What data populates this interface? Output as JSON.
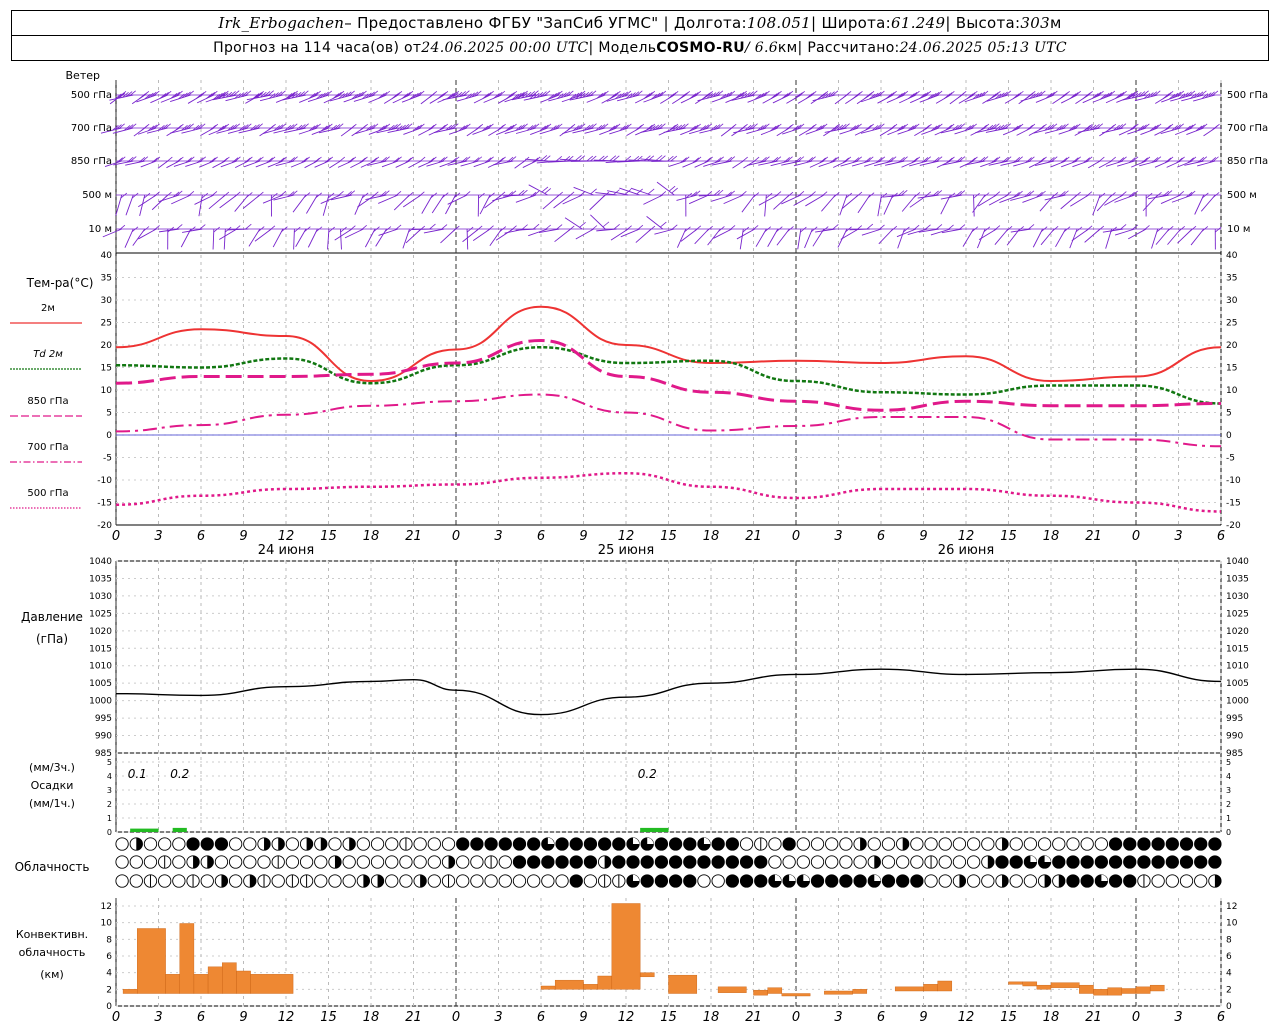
{
  "header": {
    "station": "Irk_Erbogachen",
    "provider": " – Предоставлено ФГБУ \"ЗапСиб УГМС\" | Долгота: ",
    "lon": "108.051",
    "lat_label": " | Широта: ",
    "lat": "61.249",
    "alt_label": " | Высота: ",
    "alt": "303",
    "alt_unit": "м",
    "fc_label": "Прогноз на 114 часа(ов) от ",
    "fc_start": "24.06.2025 00:00 UTC",
    "model_label": "  | Модель ",
    "model": "COSMO-RU",
    "res": " / 6.6",
    "res_unit": "км",
    "calc_label": " | Рассчитано: ",
    "calc": "24.06.2025 05:13 UTC"
  },
  "colors": {
    "wind": "#7722cc",
    "t2m": "#ee3333",
    "td2m": "#117711",
    "t850": "#e0198a",
    "precip": "#22bb22",
    "conv": "#ee8833"
  },
  "labels": {
    "wind": "Ветер",
    "wind_levels": [
      "500 гПа",
      "700 гПа",
      "850 гПа",
      "500 м",
      "10  м"
    ],
    "temp": "Тем-ра(°С)",
    "legend": [
      "2м",
      "Td  2м",
      "850 гПа",
      "700 гПа",
      "500 гПа"
    ],
    "pressure": [
      "Давление",
      "(гПа)"
    ],
    "precip": [
      "(мм/3ч.)",
      "Осадки",
      "(мм/1ч.)"
    ],
    "cloud": "Облачность",
    "conv": [
      "Конвективн.",
      "облачность",
      "(км)"
    ],
    "days": [
      "24 июня",
      "25 июня",
      "26 июня"
    ],
    "hours": [
      "0",
      "3",
      "6",
      "9",
      "12",
      "15",
      "18",
      "21",
      "0",
      "3",
      "6",
      "9",
      "12",
      "15",
      "18",
      "21",
      "0",
      "3",
      "6",
      "9",
      "12",
      "15",
      "18",
      "21",
      "0",
      "3",
      "6"
    ],
    "precip_notes": [
      {
        "h": 1.5,
        "text": "0.1"
      },
      {
        "h": 4.5,
        "text": "0.2"
      },
      {
        "h": 37.5,
        "text": "0.2"
      }
    ]
  },
  "chart_data": [
    {
      "type": "line",
      "ylabel": "Тем-ра(°С)",
      "ylim": [
        -20,
        40
      ],
      "yticks": [
        -20,
        -15,
        -10,
        -5,
        0,
        5,
        10,
        15,
        20,
        25,
        30,
        35,
        40
      ],
      "x_hours": [
        0,
        6,
        12,
        18,
        24,
        30,
        36,
        42,
        48,
        54,
        60,
        66,
        72,
        78
      ],
      "series": [
        {
          "name": "2м",
          "values": [
            19.5,
            23.5,
            22,
            12,
            19,
            28.5,
            20,
            16,
            16.5,
            16,
            17.5,
            12,
            13,
            19.5
          ]
        },
        {
          "name": "Td  2м",
          "values": [
            15.5,
            15,
            17,
            11.5,
            15.5,
            19.5,
            16,
            16.5,
            12,
            9.5,
            9,
            11,
            11,
            7
          ]
        },
        {
          "name": "850 гПа",
          "values": [
            11.5,
            13,
            13,
            13.5,
            16,
            21,
            13,
            9.5,
            7.5,
            5.5,
            7.5,
            6.5,
            6.5,
            7
          ]
        },
        {
          "name": "700 гПа",
          "values": [
            0.8,
            2.2,
            4.5,
            6.5,
            7.5,
            9,
            5,
            1,
            2,
            4,
            4,
            -1,
            -1,
            -2.5
          ]
        },
        {
          "name": "500 гПа",
          "values": [
            -15.5,
            -13.5,
            -12,
            -11.5,
            -11,
            -9.5,
            -8.5,
            -11.5,
            -14,
            -12,
            -12,
            -13.5,
            -15,
            -17
          ]
        }
      ]
    },
    {
      "type": "line",
      "ylabel": "Давление (гПа)",
      "ylim": [
        985,
        1040
      ],
      "yticks": [
        985,
        990,
        995,
        1000,
        1005,
        1010,
        1015,
        1020,
        1025,
        1030,
        1035,
        1040
      ],
      "x_hours": [
        0,
        6,
        12,
        18,
        21,
        24,
        30,
        36,
        42,
        48,
        54,
        60,
        66,
        72,
        78
      ],
      "series": [
        {
          "name": "Давление",
          "values": [
            1002,
            1001.5,
            1004,
            1005.5,
            1006,
            1003,
            996,
            1001,
            1005,
            1007.5,
            1009,
            1007.5,
            1008,
            1009,
            1005.5
          ]
        }
      ]
    },
    {
      "type": "bar",
      "ylabel": "Осадки (мм/1ч.)",
      "ylim": [
        0,
        5
      ],
      "yticks": [
        0,
        1,
        2,
        3,
        4,
        5
      ],
      "bars": [
        {
          "h": 1,
          "w": 2,
          "v": 0.1
        },
        {
          "h": 4,
          "w": 1,
          "v": 0.15
        },
        {
          "h": 37,
          "w": 2,
          "v": 0.15
        }
      ]
    },
    {
      "type": "bar",
      "ylabel": "Конвективн. облачность (км)",
      "ylim": [
        0,
        12
      ],
      "yticks": [
        0,
        2,
        4,
        6,
        8,
        10,
        12
      ],
      "bars": [
        {
          "h": 0.5,
          "w": 1,
          "bot": 1.5,
          "top": 2
        },
        {
          "h": 1.5,
          "w": 2,
          "bot": 1.5,
          "top": 9.3
        },
        {
          "h": 3.5,
          "w": 1,
          "bot": 1.5,
          "top": 3.8
        },
        {
          "h": 4.5,
          "w": 1,
          "bot": 1.5,
          "top": 9.9
        },
        {
          "h": 5.5,
          "w": 1,
          "bot": 1.5,
          "top": 3.8
        },
        {
          "h": 6.5,
          "w": 1,
          "bot": 1.5,
          "top": 4.7
        },
        {
          "h": 7.5,
          "w": 1,
          "bot": 1.5,
          "top": 5.2
        },
        {
          "h": 8.5,
          "w": 1,
          "bot": 1.5,
          "top": 4.2
        },
        {
          "h": 9.5,
          "w": 3,
          "bot": 1.5,
          "top": 3.8
        },
        {
          "h": 30,
          "w": 1,
          "bot": 2,
          "top": 2.4
        },
        {
          "h": 31,
          "w": 2,
          "bot": 2,
          "top": 3.1
        },
        {
          "h": 33,
          "w": 1,
          "bot": 2,
          "top": 2.6
        },
        {
          "h": 34,
          "w": 1,
          "bot": 2,
          "top": 3.6
        },
        {
          "h": 35,
          "w": 2,
          "bot": 2,
          "top": 12.3
        },
        {
          "h": 37,
          "w": 1,
          "bot": 3.5,
          "top": 4
        },
        {
          "h": 39,
          "w": 2,
          "bot": 1.5,
          "top": 3.7
        },
        {
          "h": 42.5,
          "w": 2,
          "bot": 1.6,
          "top": 2.3
        },
        {
          "h": 45,
          "w": 1,
          "bot": 1.3,
          "top": 1.9
        },
        {
          "h": 46,
          "w": 1,
          "bot": 1.5,
          "top": 2.2
        },
        {
          "h": 47,
          "w": 2,
          "bot": 1.2,
          "top": 1.5
        },
        {
          "h": 50,
          "w": 2,
          "bot": 1.4,
          "top": 1.8
        },
        {
          "h": 52,
          "w": 1,
          "bot": 1.5,
          "top": 2
        },
        {
          "h": 55,
          "w": 2,
          "bot": 1.8,
          "top": 2.3
        },
        {
          "h": 57,
          "w": 1,
          "bot": 1.8,
          "top": 2.6
        },
        {
          "h": 58,
          "w": 1,
          "bot": 1.8,
          "top": 3
        },
        {
          "h": 63,
          "w": 1,
          "bot": 2.6,
          "top": 2.9
        },
        {
          "h": 64,
          "w": 1,
          "bot": 2.4,
          "top": 2.9
        },
        {
          "h": 65,
          "w": 1,
          "bot": 2,
          "top": 2.5
        },
        {
          "h": 66,
          "w": 2,
          "bot": 2.2,
          "top": 2.8
        },
        {
          "h": 68,
          "w": 1,
          "bot": 1.5,
          "top": 2.5
        },
        {
          "h": 69,
          "w": 1,
          "bot": 1.3,
          "top": 2
        },
        {
          "h": 70,
          "w": 1,
          "bot": 1.3,
          "top": 2.2
        },
        {
          "h": 71,
          "w": 1,
          "bot": 1.5,
          "top": 2.1
        },
        {
          "h": 72,
          "w": 1,
          "bot": 1.5,
          "top": 2.3
        },
        {
          "h": 73,
          "w": 1,
          "bot": 1.8,
          "top": 2.5
        }
      ]
    }
  ]
}
